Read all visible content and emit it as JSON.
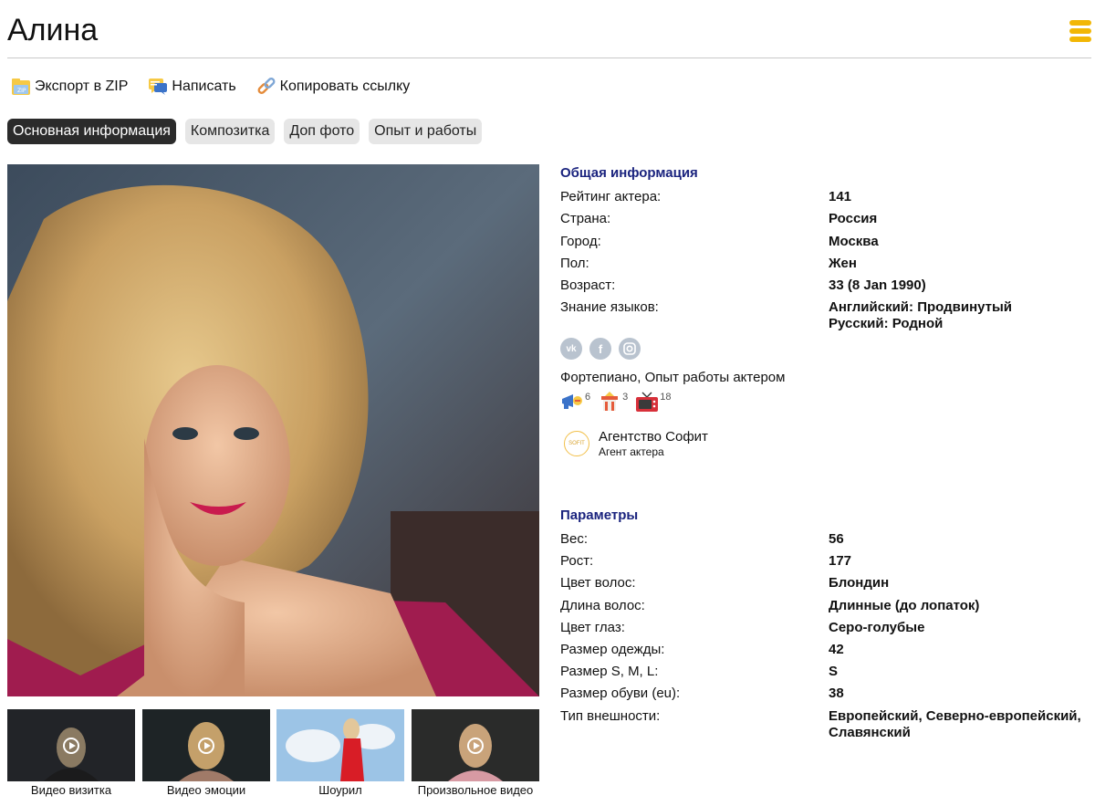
{
  "header": {
    "title": "Алина"
  },
  "actions": [
    {
      "label": "Экспорт в ZIP",
      "icon": "zip-folder-icon"
    },
    {
      "label": "Написать",
      "icon": "message-icon"
    },
    {
      "label": "Копировать ссылку",
      "icon": "link-icon"
    }
  ],
  "tabs": [
    {
      "label": "Основная информация",
      "active": true
    },
    {
      "label": "Композитка",
      "active": false
    },
    {
      "label": "Доп фото",
      "active": false
    },
    {
      "label": "Опыт и работы",
      "active": false
    }
  ],
  "videos": [
    {
      "label": "Видео визитка"
    },
    {
      "label": "Видео эмоции"
    },
    {
      "label": "Шоурил"
    },
    {
      "label": "Произвольное видео"
    }
  ],
  "general": {
    "title": "Общая информация",
    "rows": [
      {
        "k": "Рейтинг актера:",
        "v": "141"
      },
      {
        "k": "Страна:",
        "v": "Россия"
      },
      {
        "k": "Город:",
        "v": "Москва"
      },
      {
        "k": "Пол:",
        "v": "Жен"
      },
      {
        "k": "Возраст:",
        "v": "33 (8 Jan 1990)"
      },
      {
        "k": "Знание языков:",
        "v": "Английский: Продвинутый",
        "v2": "Русский: Родной"
      }
    ],
    "social": [
      "vk-icon",
      "facebook-icon",
      "instagram-icon"
    ],
    "skills": "Фортепиано, Опыт работы актером",
    "badges": [
      {
        "icon": "advertising-icon",
        "count": "6"
      },
      {
        "icon": "theater-icon",
        "count": "3"
      },
      {
        "icon": "tv-icon",
        "count": "18"
      }
    ],
    "agency": {
      "logo_text": "SOFIT",
      "name": "Агентство Софит",
      "role": "Агент актера"
    }
  },
  "params": {
    "title": "Параметры",
    "rows": [
      {
        "k": "Вес:",
        "v": "56"
      },
      {
        "k": "Рост:",
        "v": "177"
      },
      {
        "k": "Цвет волос:",
        "v": "Блондин"
      },
      {
        "k": "Длина волос:",
        "v": "Длинные (до лопаток)"
      },
      {
        "k": "Цвет глаз:",
        "v": "Серо-голубые"
      },
      {
        "k": "Размер одежды:",
        "v": "42"
      },
      {
        "k": "Размер S, M, L:",
        "v": "S"
      },
      {
        "k": "Размер обуви (eu):",
        "v": "38"
      },
      {
        "k": "Тип внешности:",
        "v": "Европейский, Северно-европейский,",
        "v2": "Славянский"
      }
    ]
  },
  "colors": {
    "accent": "#f2b705",
    "section_title": "#1a237e",
    "active_tab": "#2b2b2b",
    "tab": "#e6e6e6"
  }
}
